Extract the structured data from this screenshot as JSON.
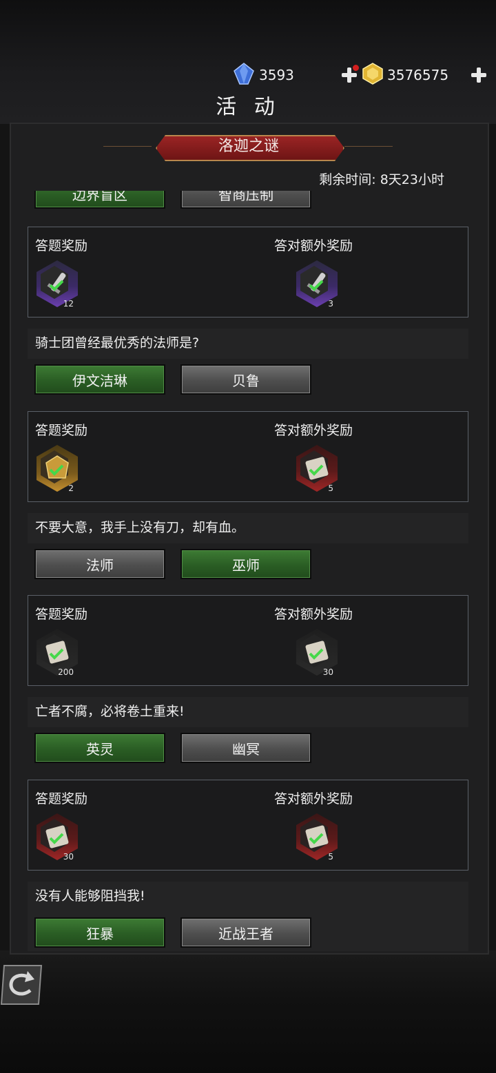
{
  "header": {
    "title": "活 动",
    "diamond": {
      "icon": "blue-gem-icon",
      "amount": "3593"
    },
    "gold": {
      "icon": "gold-coin-icon",
      "amount": "3576575"
    }
  },
  "event": {
    "banner_title": "洛迦之谜",
    "remaining": "剩余时间: 8天23小时"
  },
  "top_answers": {
    "a": "边界盲区",
    "b": "智商压制",
    "selected": "a"
  },
  "sections": [
    {
      "reward_label": "答题奖励",
      "bonus_label": "答对额外奖励",
      "reward": {
        "icon": "sword-icon",
        "qty": "12"
      },
      "bonus": {
        "icon": "sword-icon",
        "qty": "3"
      },
      "question": "骑士团曾经最优秀的法师是?",
      "answers": [
        "伊文洁琳",
        "贝鲁"
      ],
      "selected": 0
    },
    {
      "reward_label": "答题奖励",
      "bonus_label": "答对额外奖励",
      "reward": {
        "icon": "gold-chest-icon",
        "qty": "2"
      },
      "bonus": {
        "icon": "scroll-icon",
        "qty": "5"
      },
      "question": "不要大意，我手上没有刀，却有血。",
      "answers": [
        "法师",
        "巫师"
      ],
      "selected": 1
    },
    {
      "reward_label": "答题奖励",
      "bonus_label": "答对额外奖励",
      "reward": {
        "icon": "scroll-icon",
        "qty": "200"
      },
      "bonus": {
        "icon": "scroll-icon",
        "qty": "30"
      },
      "question": "亡者不腐，必将卷土重来!",
      "answers": [
        "英灵",
        "幽冥"
      ],
      "selected": 0
    },
    {
      "reward_label": "答题奖励",
      "bonus_label": "答对额外奖励",
      "reward": {
        "icon": "scroll-icon",
        "qty": "30"
      },
      "bonus": {
        "icon": "scroll-icon",
        "qty": "5"
      },
      "question": "没有人能够阻挡我!",
      "answers": [
        "狂暴",
        "近战王者"
      ],
      "selected": 0
    }
  ],
  "colors": {
    "selected": "#2f6b28",
    "unselected": "#5a5a5a",
    "banner": "#8a1e1e"
  }
}
